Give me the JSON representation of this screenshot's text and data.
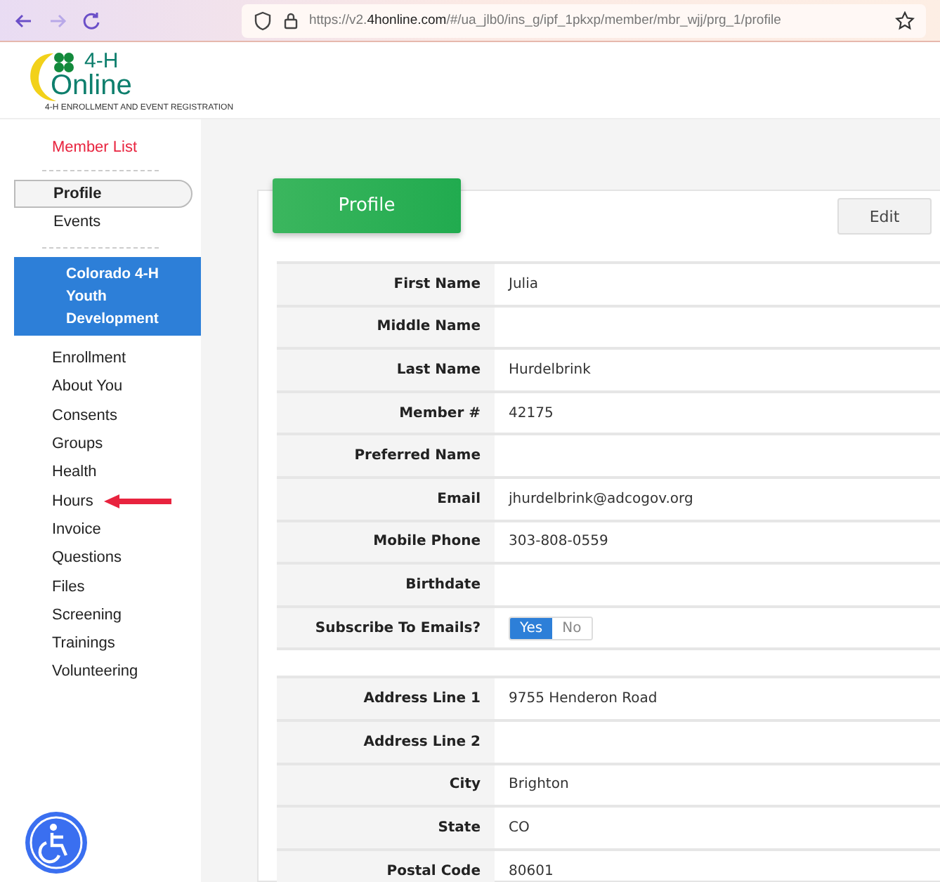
{
  "browser": {
    "url_host": "https://v2.",
    "url_domain": "4honline.com",
    "url_path": "/#/ua_jlb0/ins_g/ipf_1pkxp/member/mbr_wjj/prg_1/profile"
  },
  "logo": {
    "mark": "4-H",
    "word": "Online",
    "tagline": "4-H ENROLLMENT AND EVENT REGISTRATION"
  },
  "sidebar": {
    "top_link": "Member List",
    "member_items": [
      {
        "label": "Profile",
        "selected": true
      },
      {
        "label": "Events",
        "selected": false
      }
    ],
    "program": "Colorado 4-H Youth Development",
    "program_items": [
      {
        "label": "Enrollment",
        "marked": false
      },
      {
        "label": "About You",
        "marked": false
      },
      {
        "label": "Consents",
        "marked": false
      },
      {
        "label": "Groups",
        "marked": false
      },
      {
        "label": "Health",
        "marked": false
      },
      {
        "label": "Hours",
        "marked": true
      },
      {
        "label": "Invoice",
        "marked": false
      },
      {
        "label": "Questions",
        "marked": false
      },
      {
        "label": "Files",
        "marked": false
      },
      {
        "label": "Screening",
        "marked": false
      },
      {
        "label": "Trainings",
        "marked": false
      },
      {
        "label": "Volunteering",
        "marked": false
      }
    ]
  },
  "card": {
    "title": "Profile",
    "edit_button": "Edit",
    "sections": [
      [
        {
          "kind": "text",
          "label": "First Name",
          "value": "Julia"
        },
        {
          "kind": "text",
          "label": "Middle Name"
        },
        {
          "kind": "text",
          "label": "Last Name",
          "value": "Hurdelbrink"
        },
        {
          "kind": "text",
          "label": "Member #",
          "value": "42175"
        },
        {
          "kind": "text",
          "label": "Preferred Name"
        },
        {
          "kind": "text",
          "label": "Email",
          "value": "jhurdelbrink@adcogov.org"
        },
        {
          "kind": "text",
          "label": "Mobile Phone",
          "value": "303-808-0559"
        },
        {
          "kind": "text",
          "label": "Birthdate"
        },
        {
          "kind": "toggle",
          "label": "Subscribe To Emails?",
          "options": [
            {
              "label": "Yes",
              "selected": true
            },
            {
              "label": "No",
              "selected": false
            }
          ]
        }
      ],
      [
        {
          "kind": "text",
          "label": "Address Line 1",
          "value": "9755 Henderon Road"
        },
        {
          "kind": "text",
          "label": "Address Line 2"
        },
        {
          "kind": "text",
          "label": "City",
          "value": "Brighton"
        },
        {
          "kind": "text",
          "label": "State",
          "value": "CO"
        },
        {
          "kind": "text",
          "label": "Postal Code",
          "value": "80601"
        }
      ]
    ]
  }
}
